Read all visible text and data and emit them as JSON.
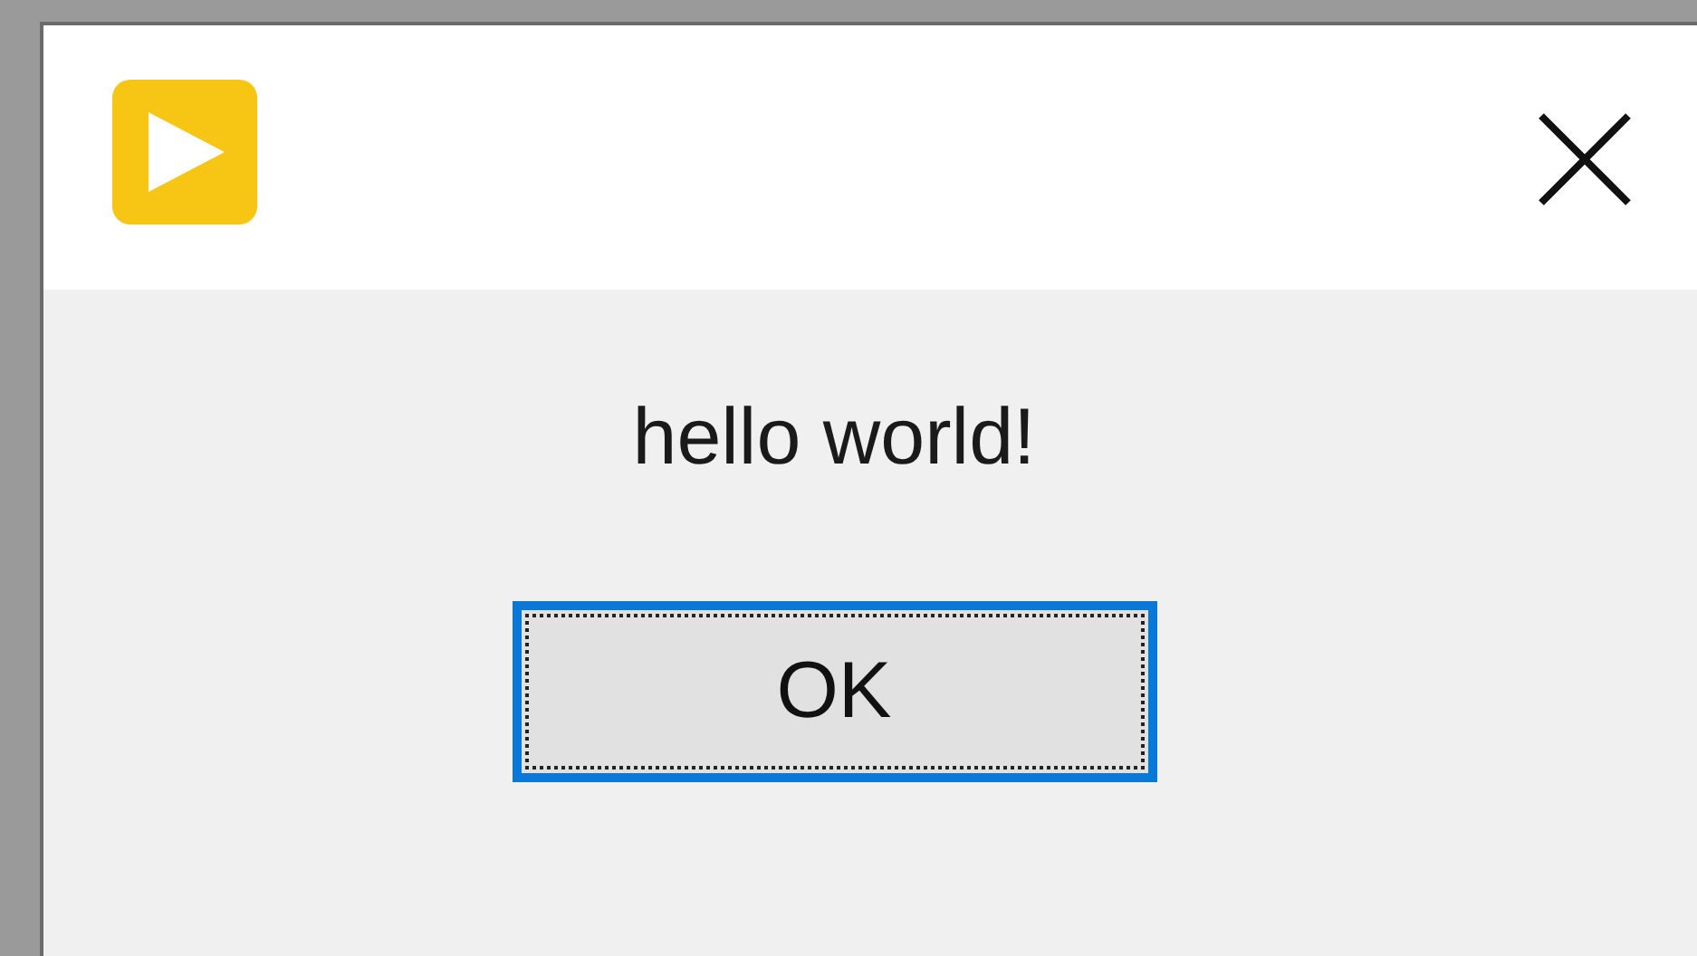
{
  "dialog": {
    "message": "hello world!",
    "buttons": [
      {
        "label": "OK",
        "focused": true
      }
    ]
  }
}
